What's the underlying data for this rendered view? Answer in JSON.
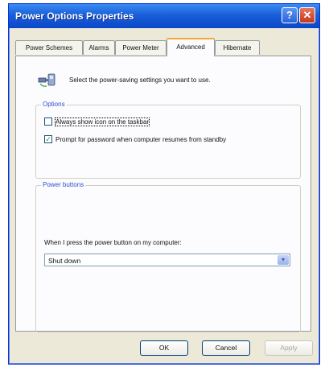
{
  "window": {
    "title": "Power Options Properties",
    "help_glyph": "?",
    "close_glyph": "✕"
  },
  "tabs": [
    {
      "label": "Power Schemes"
    },
    {
      "label": "Alarms"
    },
    {
      "label": "Power Meter"
    },
    {
      "label": "Advanced",
      "active": true
    },
    {
      "label": "Hibernate"
    }
  ],
  "header": {
    "text": "Select the power-saving settings you want to use.",
    "icon": "power-options-icon"
  },
  "options": {
    "label": "Options",
    "items": [
      {
        "label": "Always show icon on the taskbar",
        "checked": false,
        "check_glyph": ""
      },
      {
        "label": "Prompt for password when computer resumes from standby",
        "checked": true,
        "check_glyph": "✓"
      }
    ]
  },
  "power_buttons": {
    "label": "Power buttons",
    "prompt": "When I press the power button on my computer:",
    "selected": "Shut down",
    "arrow_glyph": "▾"
  },
  "buttons": {
    "ok": "OK",
    "cancel": "Cancel",
    "apply": "Apply"
  },
  "colors": {
    "title_bar": "#1a5fd9",
    "dialog_bg": "#ece9d8",
    "group_label": "#2d4ec9",
    "active_tab_accent": "#f5a838"
  }
}
